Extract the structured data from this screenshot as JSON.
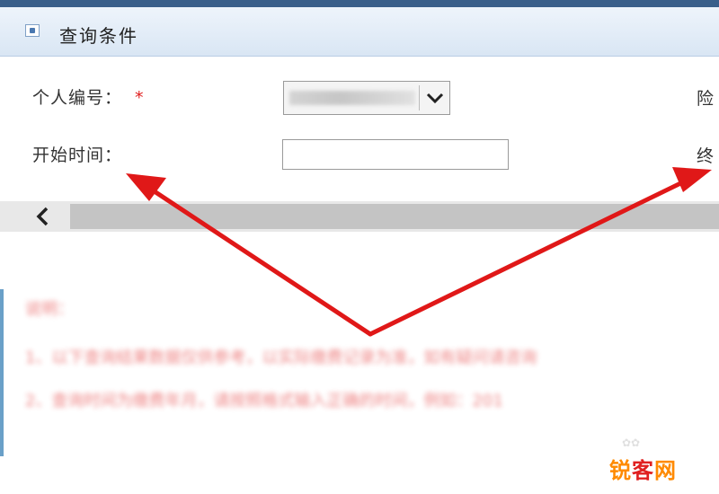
{
  "panel": {
    "title": "查询条件"
  },
  "form": {
    "personal_id_label": "个人编号：",
    "required_mark": "*",
    "start_time_label": "开始时间：",
    "insurance_label_partial": "险",
    "end_time_label_partial": "终"
  },
  "notes": {
    "heading": "说明：",
    "line1": "1、以下查询结果数据仅供参考，以实际缴费记录为准，如有疑问请咨询",
    "line2": "2、查询时间为缴费年月，请按照格式输入正确的时间，例如：201"
  },
  "watermark": {
    "part1": "锐",
    "part2": "客",
    "part3": "网"
  },
  "colors": {
    "accent": "#e02020",
    "header_bg": "#d9e6f4",
    "topbar": "#3a5f8a"
  }
}
